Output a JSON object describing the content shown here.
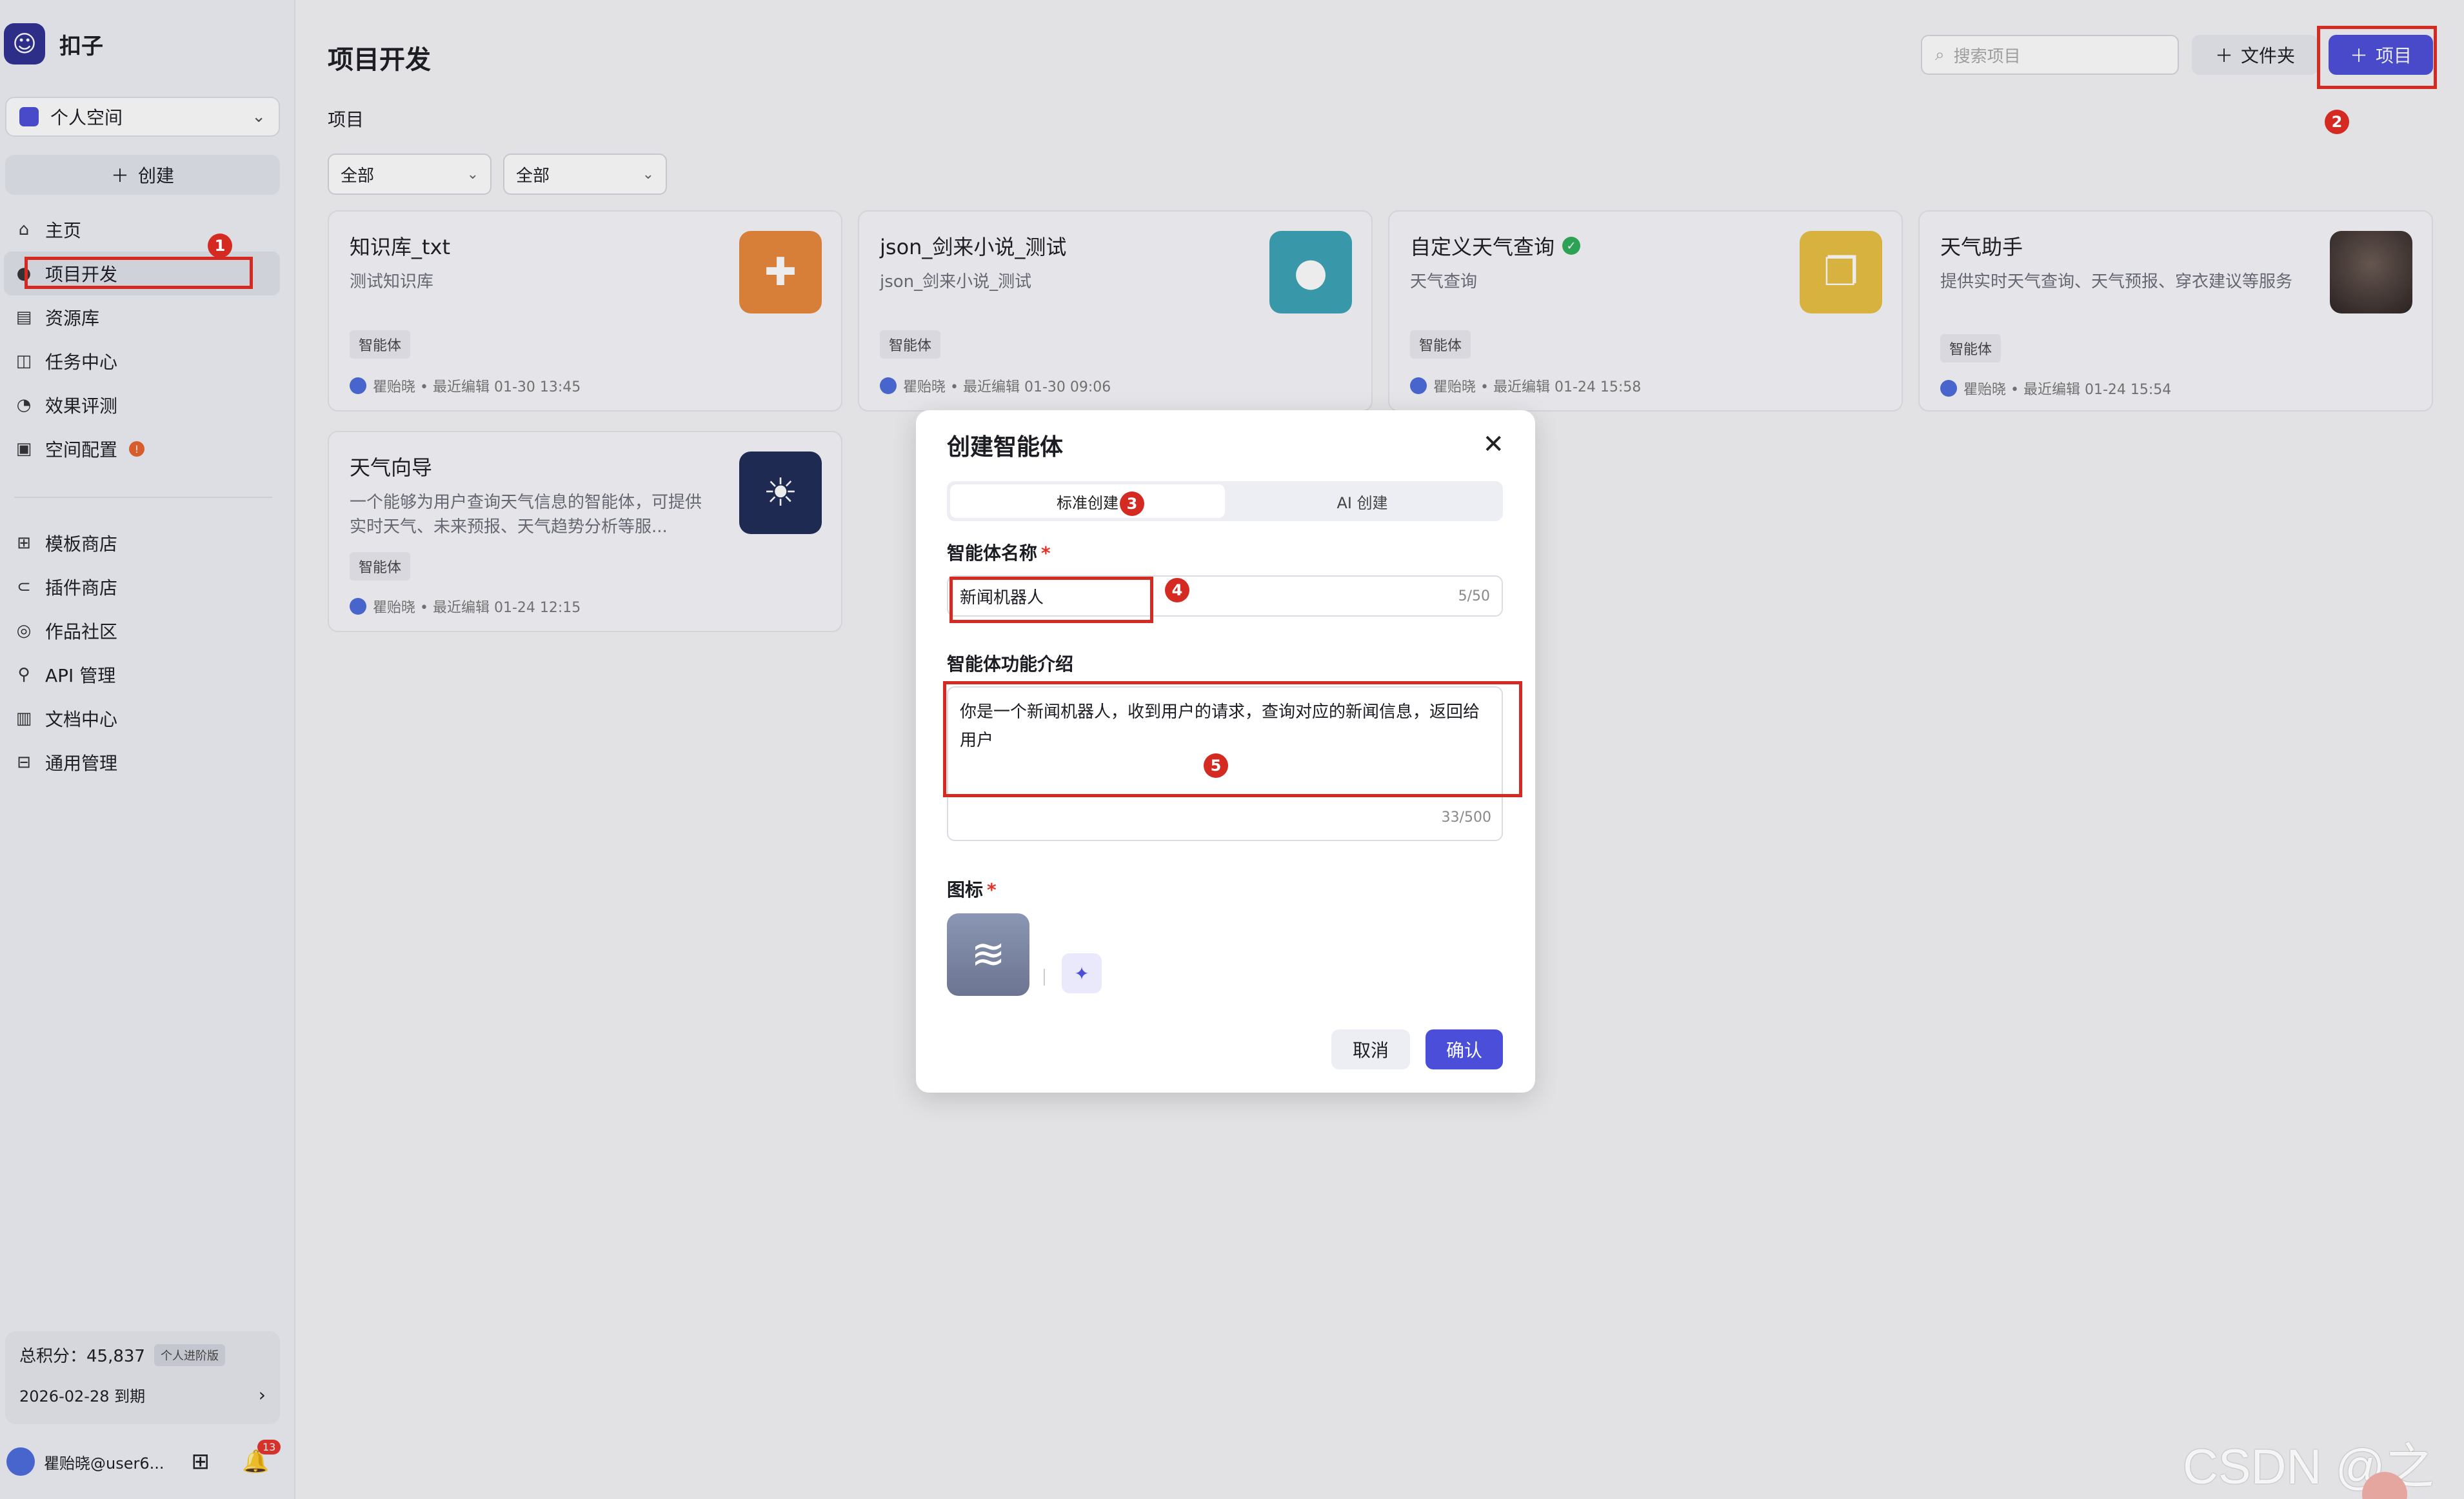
{
  "brand": {
    "name": "扣子",
    "logo_icon": "bot-face-icon"
  },
  "sidebar": {
    "space": "个人空间",
    "create": "创建",
    "items": [
      {
        "label": "主页",
        "icon": "home-icon"
      },
      {
        "label": "项目开发",
        "icon": "project-icon"
      },
      {
        "label": "资源库",
        "icon": "library-icon"
      },
      {
        "label": "任务中心",
        "icon": "task-icon"
      },
      {
        "label": "效果评测",
        "icon": "eval-icon"
      },
      {
        "label": "空间配置",
        "icon": "config-icon"
      }
    ],
    "items2": [
      {
        "label": "模板商店",
        "icon": "template-icon"
      },
      {
        "label": "插件商店",
        "icon": "plugin-icon"
      },
      {
        "label": "作品社区",
        "icon": "community-icon"
      },
      {
        "label": "API 管理",
        "icon": "api-icon"
      },
      {
        "label": "文档中心",
        "icon": "doc-icon"
      },
      {
        "label": "通用管理",
        "icon": "manage-icon"
      }
    ],
    "points_label": "总积分：45,837",
    "plan": "个人进阶版",
    "expire": "2026-02-28 到期",
    "user": "瞿贻晓@user6...",
    "notifications": "13"
  },
  "header": {
    "title": "项目开发",
    "search_placeholder": "搜索项目",
    "folder_button": "文件夹",
    "project_button": "项目"
  },
  "section_label": "项目",
  "filters": [
    "全部",
    "全部"
  ],
  "cards": [
    {
      "title": "知识库_txt",
      "desc": "测试知识库",
      "tag": "智能体",
      "meta": "瞿贻晓 • 最近编辑 01-30 13:45",
      "icon": "puzzle-icon",
      "color": "#e8873a"
    },
    {
      "title": "json_剑来小说_测试",
      "desc": "json_剑来小说_测试",
      "tag": "智能体",
      "meta": "瞿贻晓 • 最近编辑 01-30 09:06",
      "icon": "chat-bubble-icon",
      "color": "#3aa3b5"
    },
    {
      "title": "自定义天气查询",
      "desc": "天气查询",
      "tag": "智能体",
      "meta": "瞿贻晓 • 最近编辑 01-24 15:58",
      "icon": "copy-squares-icon",
      "color": "#e8c040",
      "verified": true
    },
    {
      "title": "天气助手",
      "desc": "提供实时天气查询、天气预报、穿衣建议等服务",
      "tag": "智能体",
      "meta": "瞿贻晓 • 最近编辑 01-24 15:54",
      "icon": "portrait-icon",
      "color": "#3a2e2a"
    },
    {
      "title": "天气向导",
      "desc": "一个能够为用户查询天气信息的智能体，可提供实时天气、未来预报、天气趋势分析等服...",
      "tag": "智能体",
      "meta": "瞿贻晓 • 最近编辑 01-24 12:15",
      "icon": "weather-icon",
      "color": "#1e2a55"
    }
  ],
  "modal": {
    "title": "创建智能体",
    "tab_standard": "标准创建",
    "tab_ai": "AI 创建",
    "name_label": "智能体名称",
    "name_value": "新闻机器人",
    "name_counter": "5/50",
    "desc_label": "智能体功能介绍",
    "desc_value": "你是一个新闻机器人，收到用户的请求，查询对应的新闻信息，返回给用户",
    "desc_counter": "33/500",
    "icon_label": "图标",
    "cancel": "取消",
    "confirm": "确认"
  },
  "annotations": [
    "1",
    "2",
    "3",
    "4",
    "5"
  ],
  "watermark": "CSDN @之歆",
  "colors": {
    "accent": "#4b4ed8",
    "annotation": "#d42a22"
  }
}
